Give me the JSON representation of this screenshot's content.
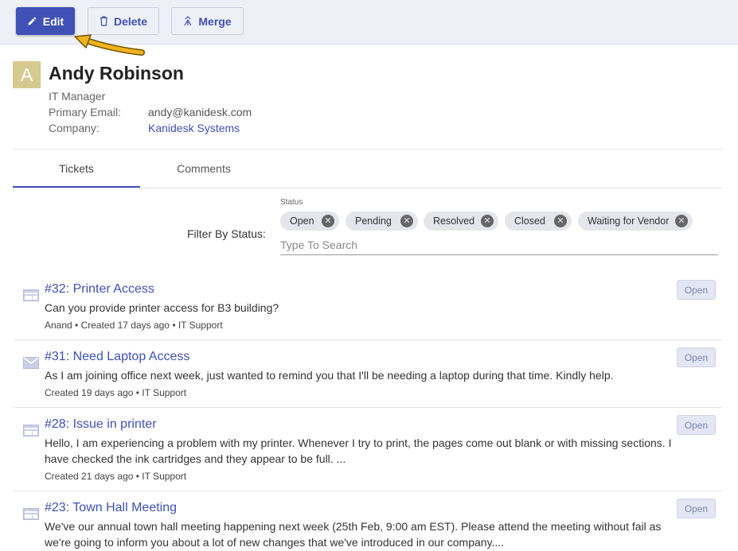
{
  "toolbar": {
    "edit_label": "Edit",
    "delete_label": "Delete",
    "merge_label": "Merge"
  },
  "contact": {
    "avatar_initial": "A",
    "name": "Andy Robinson",
    "job_title": "IT Manager",
    "email_label": "Primary Email:",
    "email": "andy@kanidesk.com",
    "company_label": "Company:",
    "company": "Kanidesk Systems"
  },
  "tabs": [
    {
      "label": "Tickets",
      "active": true
    },
    {
      "label": "Comments",
      "active": false
    }
  ],
  "filter": {
    "label": "Filter By Status:",
    "caption": "Status",
    "placeholder": "Type To Search",
    "chips": [
      "Open",
      "Pending",
      "Resolved",
      "Closed",
      "Waiting for Vendor"
    ]
  },
  "tickets": [
    {
      "icon": "web-form-icon",
      "title": "#32: Printer Access",
      "body": "Can you provide printer access for B3 building?",
      "meta": "Anand  • Created 17 days ago •  IT Support",
      "status": "Open"
    },
    {
      "icon": "mail-icon",
      "title": "#31: Need Laptop Access",
      "body": "As I am joining office next week, just wanted to remind you that I'll be needing a laptop during that time. Kindly help.",
      "meta": "Created 19 days ago •  IT Support",
      "status": "Open"
    },
    {
      "icon": "web-form-icon",
      "title": "#28: Issue in printer",
      "body": "Hello, I am experiencing a problem with my printer. Whenever I try to print, the pages come out blank or with missing sections. I have checked the ink cartridges and they appear to be full. ...",
      "meta": "Created 21 days ago •  IT Support",
      "status": "Open"
    },
    {
      "icon": "web-form-icon",
      "title": "#23: Town Hall Meeting",
      "body": "We've our annual town hall meeting happening next week (25th Feb, 9:00 am EST). Please attend the meeting without fail as we're going to inform you about a lot of new changes that we've introduced in our company....",
      "meta": "",
      "status": "Open"
    }
  ]
}
